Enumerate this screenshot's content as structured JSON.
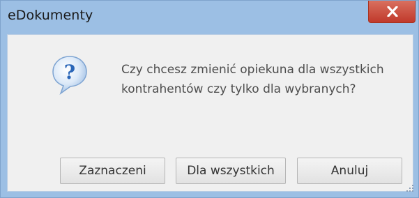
{
  "window": {
    "title": "eDokumenty",
    "close_icon": "close-x-icon"
  },
  "dialog": {
    "icon": "question-icon",
    "message": "Czy chcesz zmienić opiekuna dla wszystkich\nkontrahentów czy tylko dla wybranych?"
  },
  "buttons": {
    "selected_label": "Zaznaczeni",
    "all_label": "Dla wszystkich",
    "cancel_label": "Anuluj"
  },
  "colors": {
    "titlebar": "#9cbfe4",
    "close_button": "#c0392b",
    "dialog_background": "#f0f0f0",
    "icon_blue": "#2a66b8"
  }
}
